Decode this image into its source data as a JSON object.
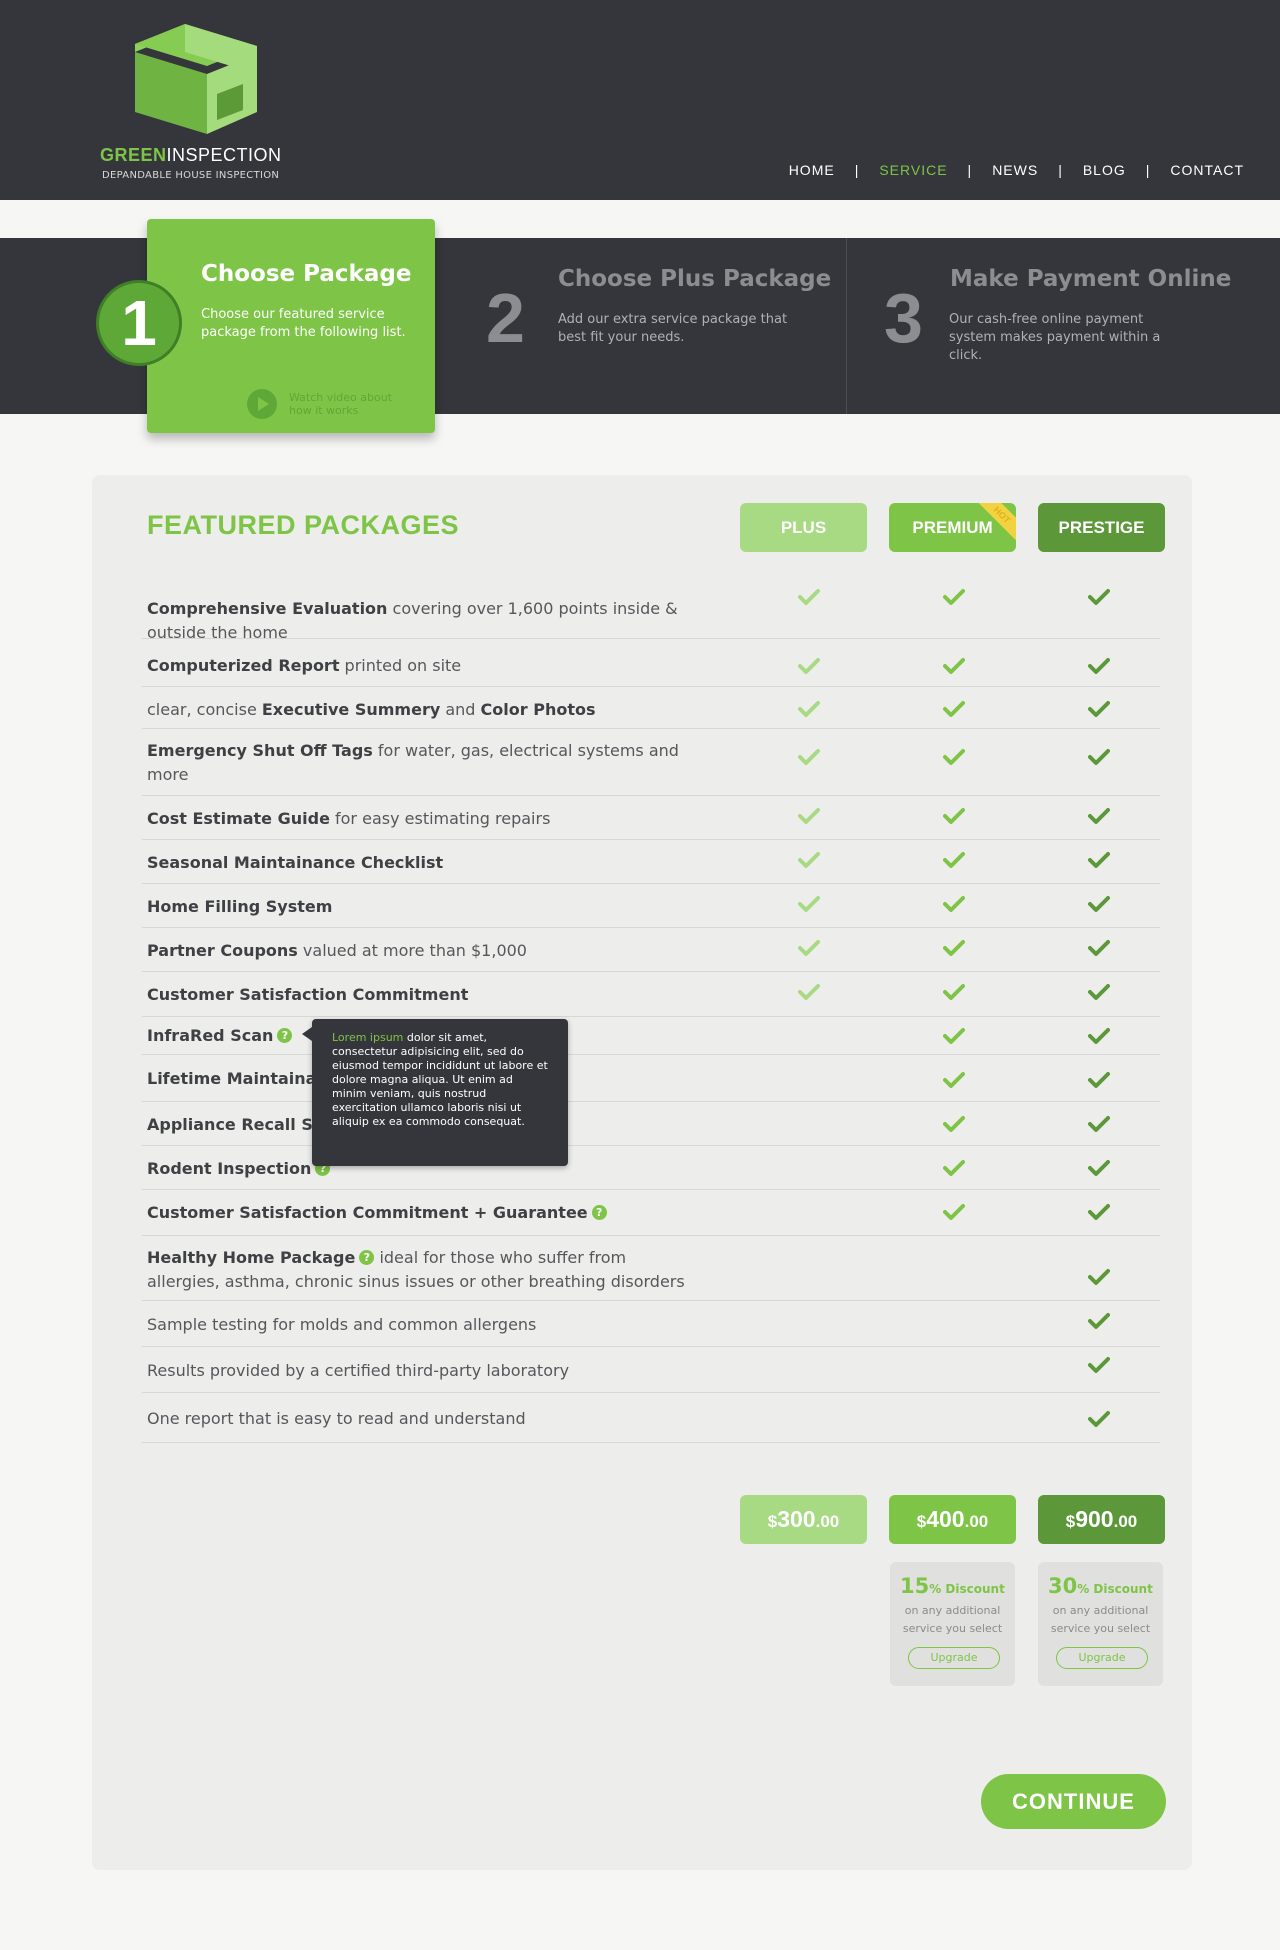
{
  "brand": {
    "name_green": "GREEN",
    "name_white": "INSPECTION",
    "tagline": "DEPANDABLE HOUSE INSPECTION",
    "accent": "#7ec447",
    "dark": "#34363b"
  },
  "nav": {
    "items": [
      "HOME",
      "SERVICE",
      "NEWS",
      "BLOG",
      "CONTACT"
    ],
    "active": "SERVICE",
    "separator": "|"
  },
  "steps": [
    {
      "num": "1",
      "title": "Choose Package",
      "desc": "Choose our featured service package from the following list.",
      "video": "Watch video about how it works"
    },
    {
      "num": "2",
      "title": "Choose Plus Package",
      "desc": "Add our extra service package that best fit your needs."
    },
    {
      "num": "3",
      "title": "Make Payment Online",
      "desc": "Our cash-free online payment system makes payment within a click."
    }
  ],
  "packages": {
    "title": "FEATURED PACKAGES",
    "columns": [
      "PLUS",
      "PREMIUM",
      "PRESTIGE"
    ],
    "hot_badge": "HOT",
    "column_colors": [
      "#a8da84",
      "#7ec447",
      "#5c983a"
    ]
  },
  "features": [
    {
      "bold": "Comprehensive Evaluation",
      "rest": " covering over 1,600 points inside & outside the home",
      "checks": [
        true,
        true,
        true
      ]
    },
    {
      "bold": "Computerized Report",
      "rest": " printed on site",
      "checks": [
        true,
        true,
        true
      ]
    },
    {
      "pre": "clear, concise ",
      "bold": "Executive Summery",
      "rest": " and ",
      "bold2": "Color Photos",
      "checks": [
        true,
        true,
        true
      ]
    },
    {
      "bold": "Emergency Shut Off Tags",
      "rest": " for water, gas, electrical systems and more",
      "checks": [
        true,
        true,
        true
      ]
    },
    {
      "bold": "Cost Estimate Guide",
      "rest": " for easy estimating repairs",
      "checks": [
        true,
        true,
        true
      ]
    },
    {
      "bold": "Seasonal Maintainance Checklist",
      "checks": [
        true,
        true,
        true
      ]
    },
    {
      "bold": "Home Filling System",
      "checks": [
        true,
        true,
        true
      ]
    },
    {
      "bold": "Partner Coupons",
      "rest": " valued at more than $1,000",
      "checks": [
        true,
        true,
        true
      ]
    },
    {
      "bold": "Customer Satisfaction Commitment",
      "checks": [
        true,
        true,
        true
      ]
    },
    {
      "bold": "InfraRed Scan",
      "help": true,
      "checks": [
        false,
        true,
        true
      ]
    },
    {
      "bold": "Lifetime Maintaina",
      "checks": [
        false,
        true,
        true
      ]
    },
    {
      "bold": "Appliance Recall S",
      "checks": [
        false,
        true,
        true
      ]
    },
    {
      "bold": "Rodent Inspection",
      "help": true,
      "checks": [
        false,
        true,
        true
      ]
    },
    {
      "bold": "Customer Satisfaction Commitment + Guarantee",
      "help": true,
      "checks": [
        false,
        true,
        true
      ]
    },
    {
      "bold": "Healthy Home Package",
      "help": true,
      "rest": " ideal for those who suffer from allergies, asthma, chronic sinus issues or other breathing disorders",
      "checks": [
        false,
        false,
        true
      ]
    },
    {
      "pre": "Sample testing for molds and common allergens",
      "checks": [
        false,
        false,
        true
      ]
    },
    {
      "pre": "Results provided by a certified third-party laboratory",
      "checks": [
        false,
        false,
        true
      ]
    },
    {
      "pre": "One report that is easy to read and understand",
      "checks": [
        false,
        false,
        true
      ]
    }
  ],
  "tooltip": {
    "highlight": "Lorem ipsum",
    "text": " dolor sit amet, consectetur adipisicing elit, sed do eiusmod tempor incididunt ut labore et dolore magna aliqua. Ut enim ad minim veniam, quis nostrud exercitation ullamco laboris nisi ut aliquip ex ea commodo consequat."
  },
  "prices": [
    {
      "currency": "$",
      "amount": "300",
      "cents": ".00"
    },
    {
      "currency": "$",
      "amount": "400",
      "cents": ".00"
    },
    {
      "currency": "$",
      "amount": "900",
      "cents": ".00"
    }
  ],
  "discounts": [
    {
      "pct": "15",
      "unit": "% Discount",
      "line1": "on any additional",
      "line2": "service you select",
      "button": "Upgrade"
    },
    {
      "pct": "30",
      "unit": "% Discount",
      "line1": "on any additional",
      "line2": "service you select",
      "button": "Upgrade"
    }
  ],
  "continue_label": "CONTINUE"
}
